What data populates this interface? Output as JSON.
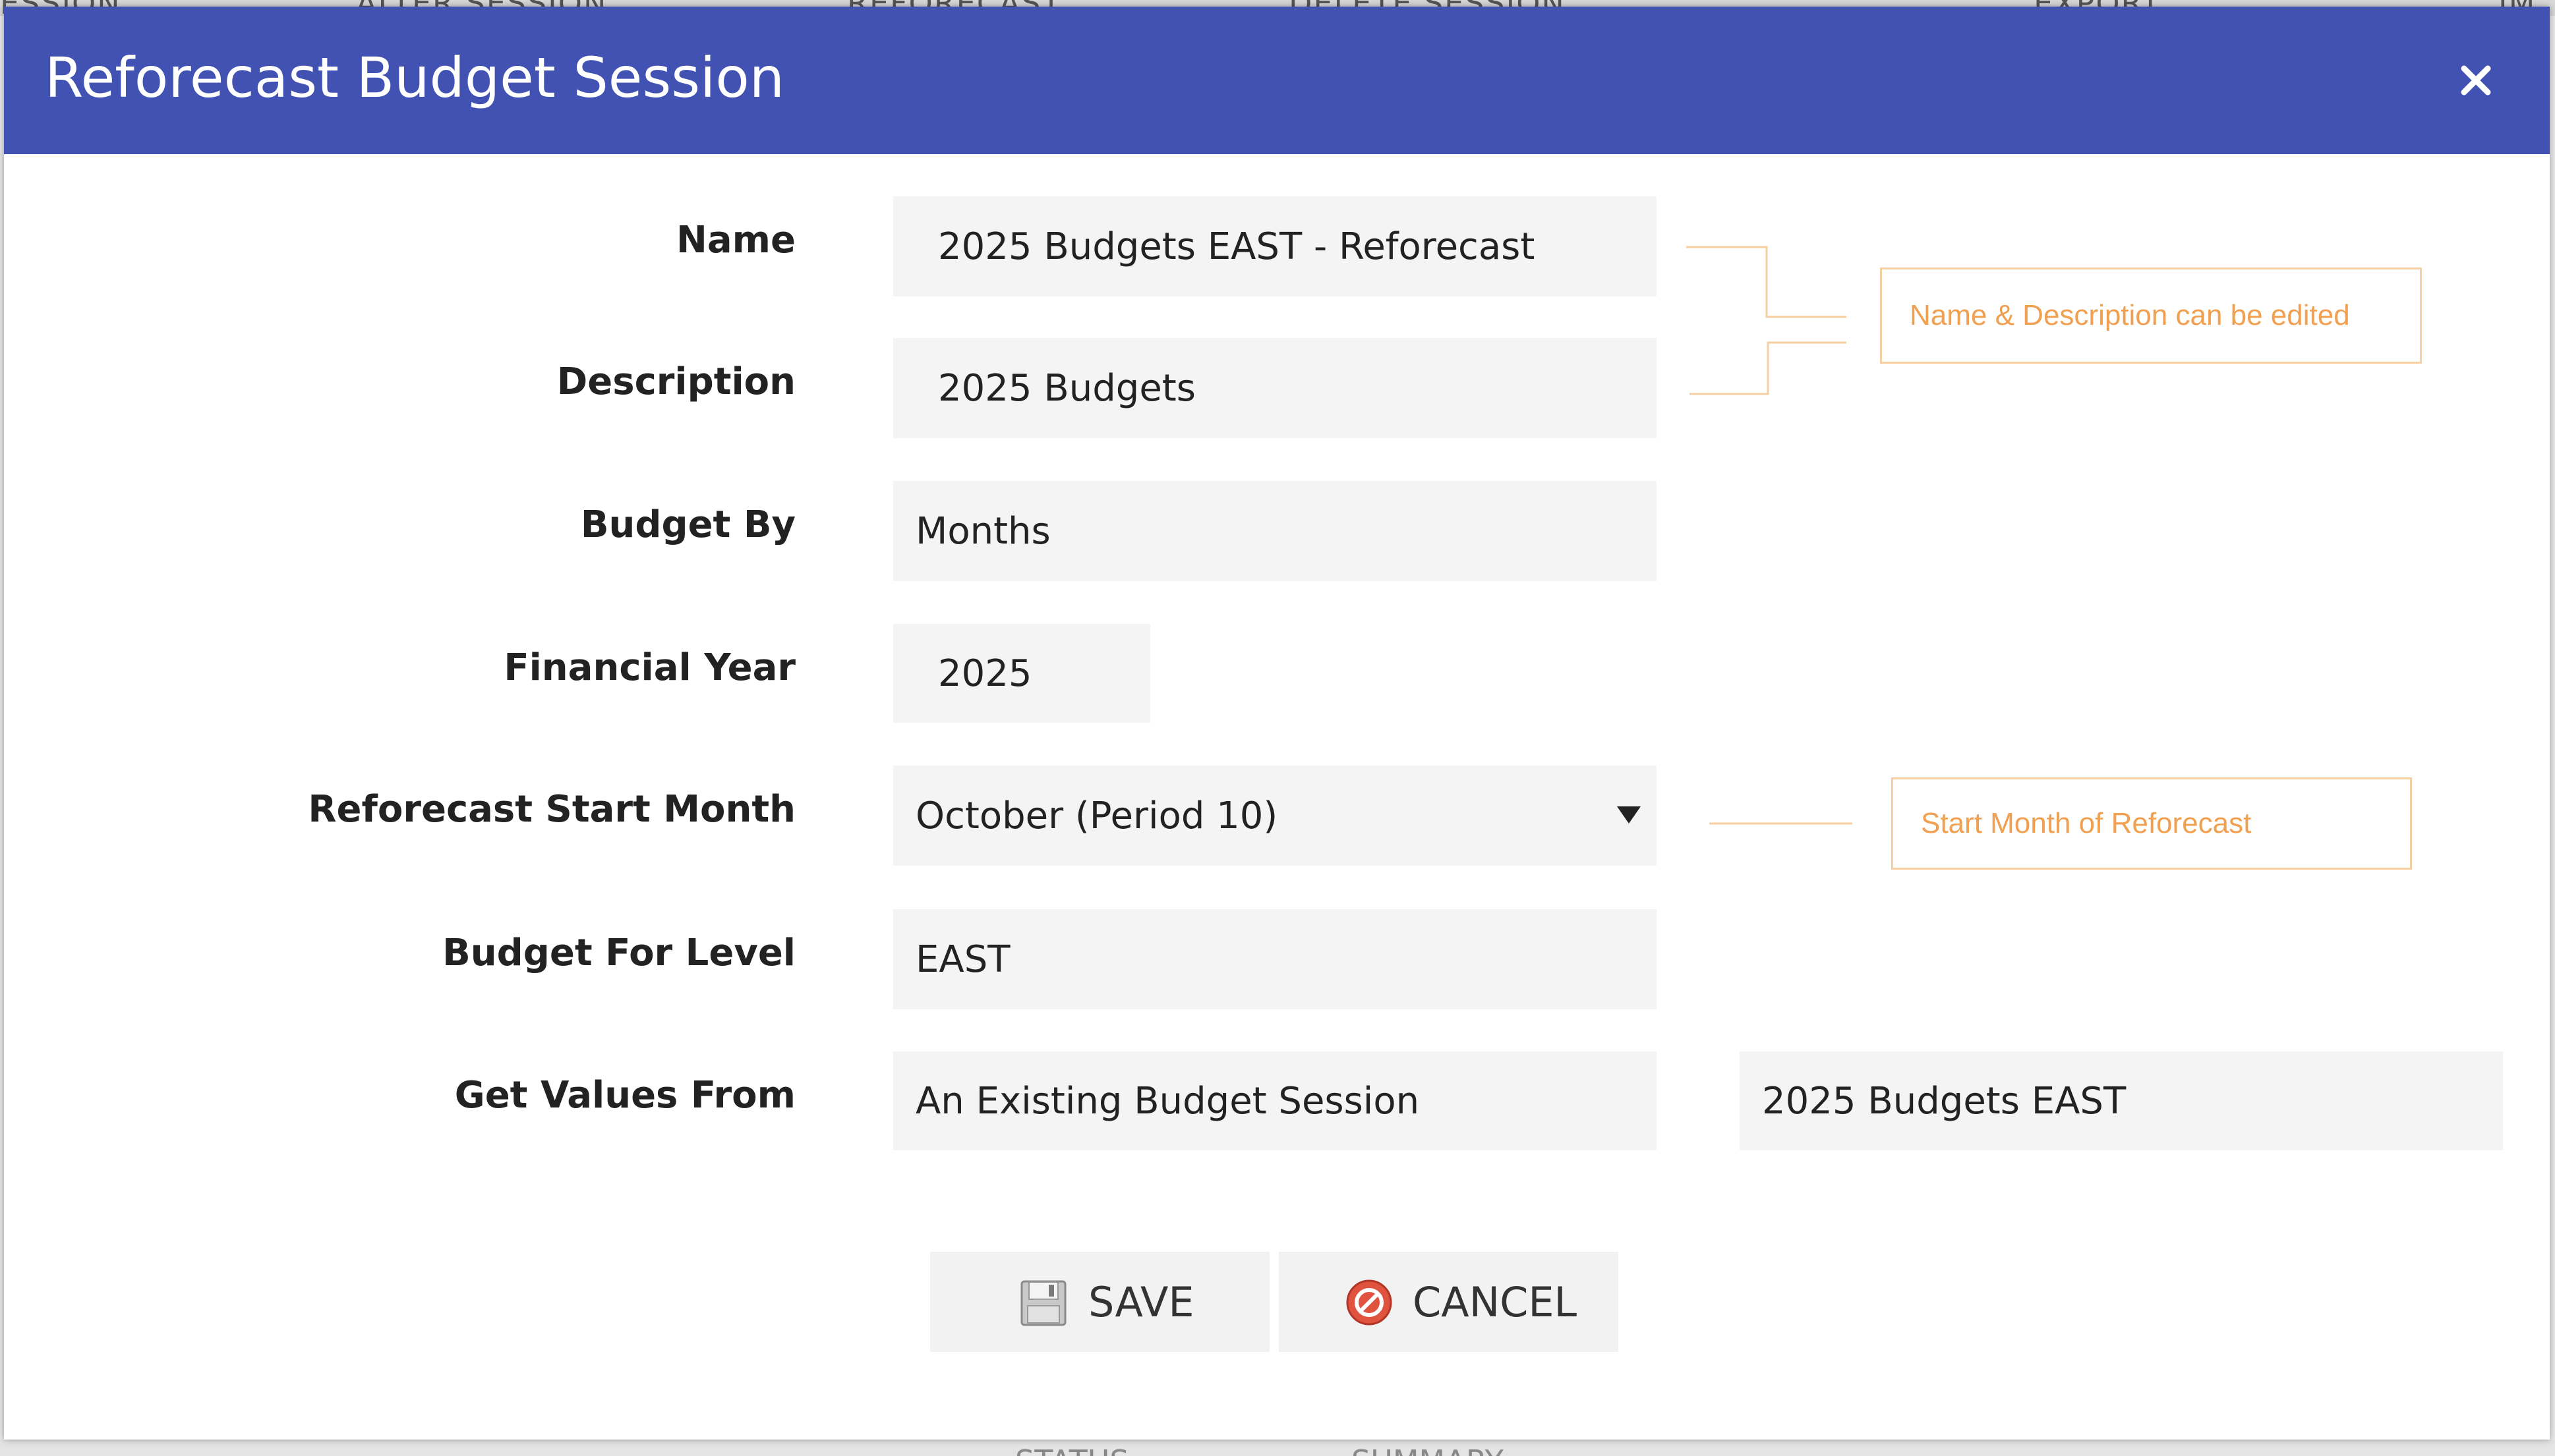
{
  "background": {
    "toolbar_items": [
      "ESSION",
      "ALTER SESSION",
      "REFORECAST",
      "DELETE SESSION",
      "EXPORT",
      "IM"
    ],
    "bottom_items": [
      "STATUS",
      "SUMMARY"
    ]
  },
  "dialog": {
    "title": "Reforecast Budget Session",
    "close_icon": "close-icon",
    "header_color": "#4152b3"
  },
  "form": {
    "name": {
      "label": "Name",
      "value": "2025 Budgets EAST - Reforecast"
    },
    "description": {
      "label": "Description",
      "value": "2025 Budgets"
    },
    "budget_by": {
      "label": "Budget By",
      "value": "Months"
    },
    "financial_year": {
      "label": "Financial Year",
      "value": "2025"
    },
    "reforecast_start_month": {
      "label": "Reforecast Start Month",
      "value": "October (Period 10)",
      "icon": "dropdown-arrow-icon"
    },
    "budget_for_level": {
      "label": "Budget For Level",
      "value": "EAST"
    },
    "get_values_from": {
      "label": "Get Values From",
      "value": "An Existing Budget Session",
      "source_session": "2025 Budgets EAST"
    }
  },
  "annotations": {
    "name_description": "Name & Description can be edited",
    "start_month": "Start Month of Reforecast",
    "color": "#f0a050"
  },
  "buttons": {
    "save": {
      "label": "SAVE",
      "icon": "save-disk-icon"
    },
    "cancel": {
      "label": "CANCEL",
      "icon": "cancel-icon"
    }
  }
}
